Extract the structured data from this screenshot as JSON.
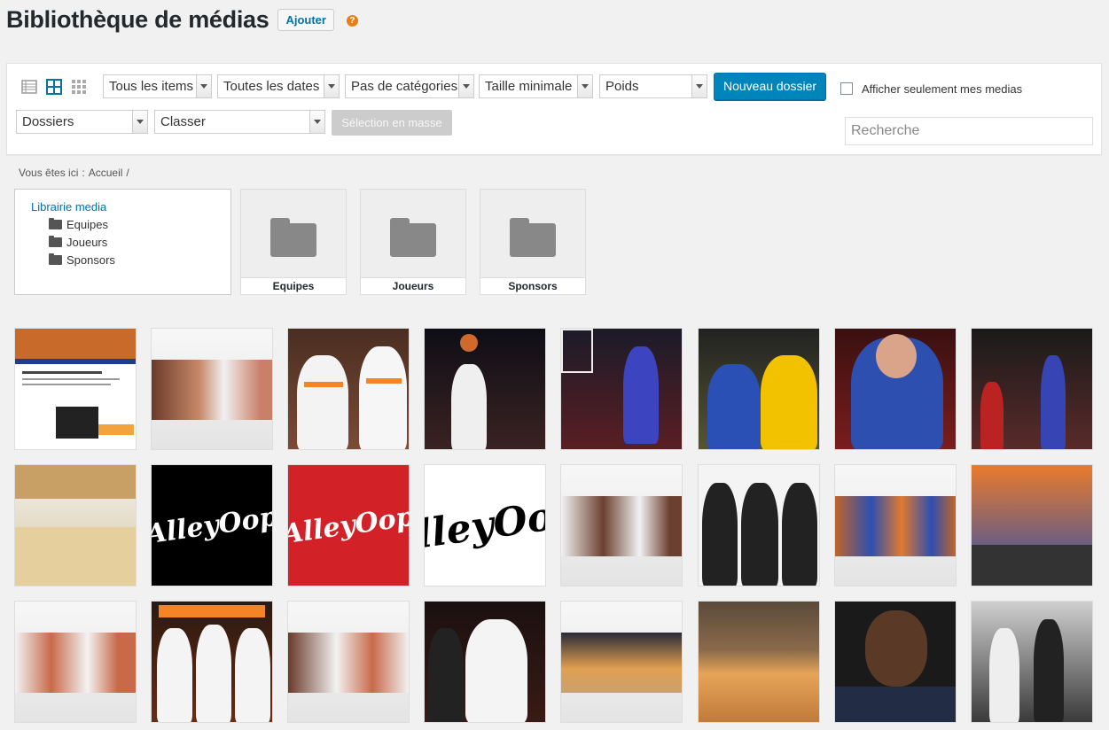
{
  "header": {
    "title": "Bibliothèque de médias",
    "add_label": "Ajouter",
    "help_glyph": "?"
  },
  "toolbar": {
    "filters": {
      "items": "Tous les items",
      "dates": "Toutes les dates",
      "categories": "Pas de catégories",
      "min_size": "Taille minimale",
      "weight": "Poids",
      "folders": "Dossiers",
      "sort": "Classer"
    },
    "new_folder_label": "Nouveau dossier",
    "only_mine_label": "Afficher seulement mes medias",
    "bulk_select_label": "Sélection en masse",
    "search_placeholder": "Recherche"
  },
  "breadcrumb": {
    "prefix": "Vous êtes ici",
    "separator": ":",
    "home": "Accueil",
    "trail_sep": "/"
  },
  "tree": {
    "root": "Librairie media",
    "items": [
      "Equipes",
      "Joueurs",
      "Sponsors"
    ]
  },
  "folders": [
    "Equipes",
    "Joueurs",
    "Sponsors"
  ],
  "logos": {
    "alley_oop": "AlleyOop",
    "alley_oop_crop": "lleyOo"
  },
  "colors": {
    "accent": "#0085ba",
    "link": "#0073aa",
    "knicks_blue": "#1d428a",
    "knicks_orange": "#f58426",
    "alleyoop_red": "#d32128"
  }
}
